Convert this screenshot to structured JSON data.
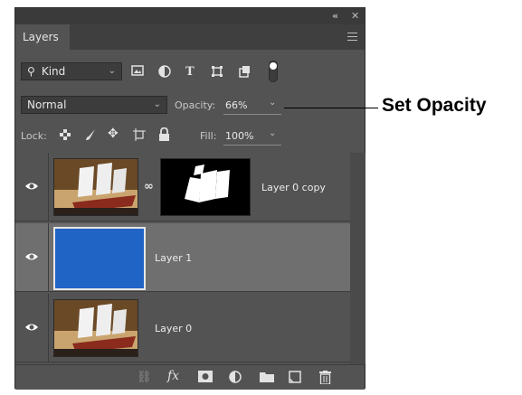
{
  "panel": {
    "tab_label": "Layers",
    "collapse_glyph": "«",
    "close_glyph": "✕"
  },
  "filter": {
    "kind_label": "Kind",
    "icons": [
      "image-filter-icon",
      "adjustment-filter-icon",
      "type-filter-icon",
      "shape-filter-icon",
      "smart-object-filter-icon",
      "filter-toggle-icon"
    ]
  },
  "blend": {
    "mode": "Normal",
    "opacity_label": "Opacity:",
    "opacity_value": "66%"
  },
  "lock": {
    "label": "Lock:",
    "icons": [
      "lock-transparent-icon",
      "lock-image-icon",
      "lock-position-icon",
      "lock-artboard-icon",
      "lock-all-icon"
    ],
    "fill_label": "Fill:",
    "fill_value": "100%"
  },
  "layers": [
    {
      "name": "Layer 0 copy",
      "thumb": "ship-photo",
      "has_mask": true,
      "selected": false
    },
    {
      "name": "Layer 1",
      "thumb": "blue-fill",
      "has_mask": false,
      "selected": true
    },
    {
      "name": "Layer 0",
      "thumb": "ship-photo",
      "has_mask": false,
      "selected": false
    }
  ],
  "bottom_icons": [
    "link-layers-icon",
    "fx-icon",
    "add-mask-icon",
    "adjustment-layer-icon",
    "new-group-icon",
    "new-layer-icon",
    "delete-layer-icon"
  ],
  "callout": {
    "text": "Set Opacity"
  },
  "colors": {
    "panel_bg": "#535353",
    "selected_row": "#6f6f6f",
    "layer1_fill": "#2064c6"
  }
}
